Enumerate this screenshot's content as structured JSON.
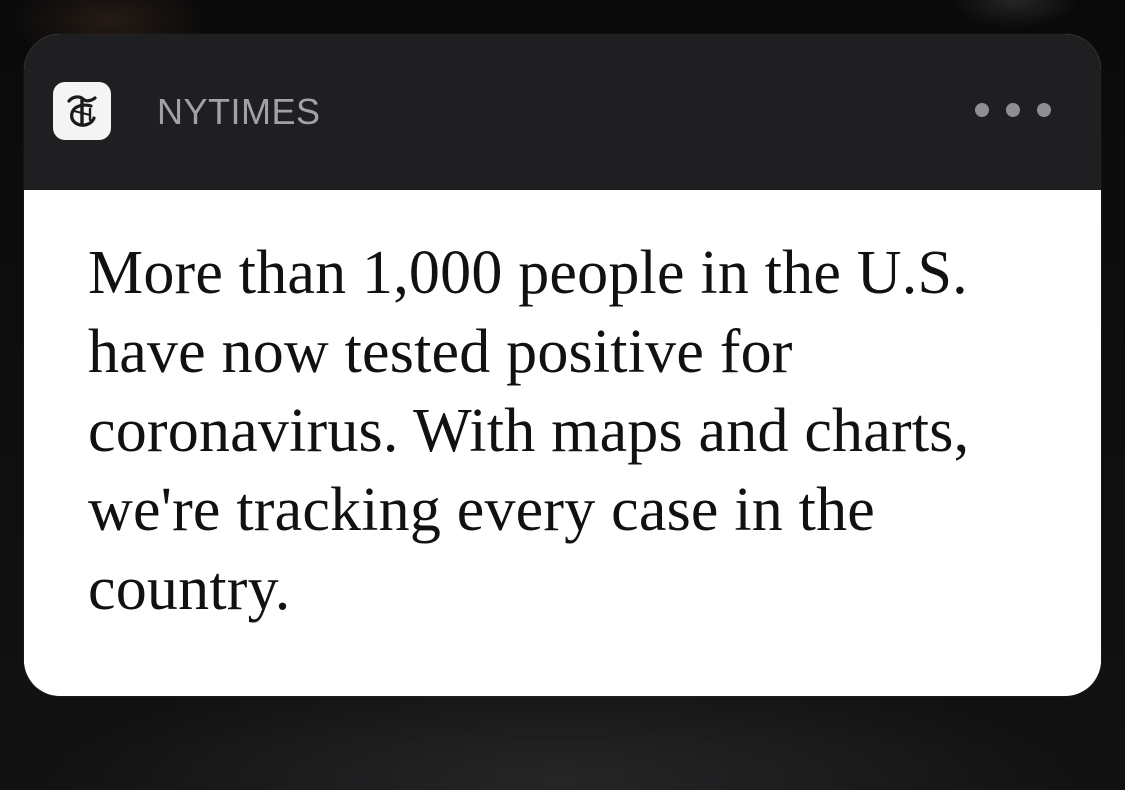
{
  "notification": {
    "app_name": "NYTIMES",
    "app_icon": "nyt-t-logo-icon",
    "more_icon": "more-ellipsis-icon",
    "message": "More than 1,000 people in the U.S. have now tested positive for coronavirus. With maps and charts, we're tracking every case in the country."
  },
  "colors": {
    "header_background": "#1f1f21",
    "body_background": "#ffffff",
    "app_name_text": "#a2a2a6",
    "message_text": "#111111",
    "screen_background": "#0b0b0c"
  }
}
